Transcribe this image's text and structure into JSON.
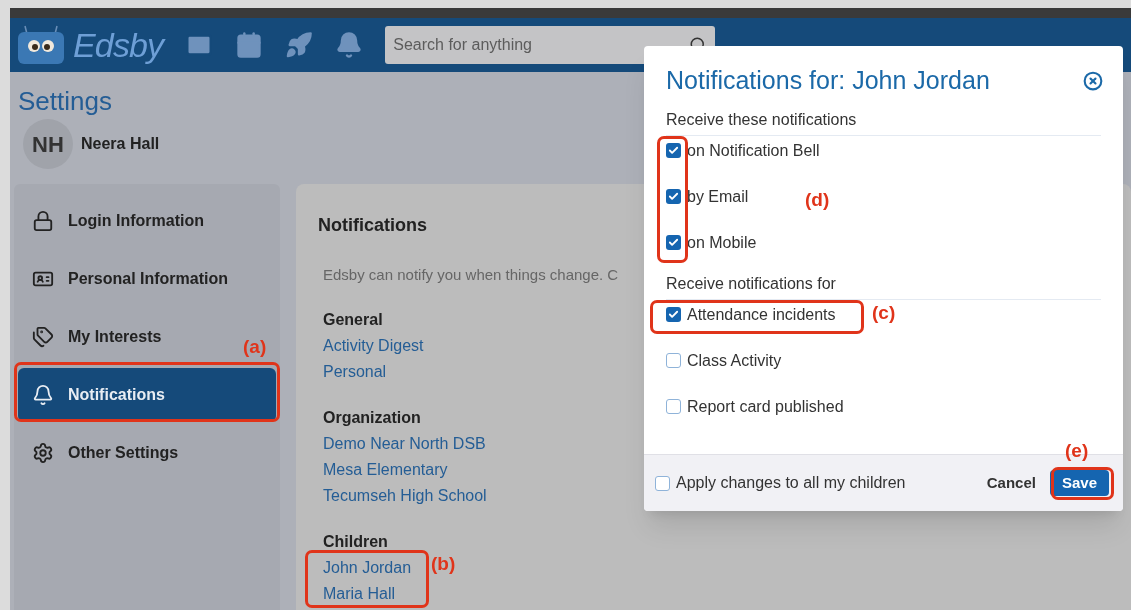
{
  "header": {
    "logo": "Edsby",
    "search": {
      "placeholder": "Search for anything"
    }
  },
  "page_title": "Settings",
  "user": {
    "initials": "NH",
    "name": "Neera Hall"
  },
  "sidebar": {
    "items": [
      {
        "label": "Login Information",
        "kind": "lock",
        "selected": false
      },
      {
        "label": "Personal Information",
        "kind": "card",
        "selected": false
      },
      {
        "label": "My Interests",
        "kind": "tags",
        "selected": false
      },
      {
        "label": "Notifications",
        "kind": "bell",
        "selected": true
      },
      {
        "label": "Other Settings",
        "kind": "gear",
        "selected": false
      }
    ]
  },
  "content": {
    "title": "Notifications",
    "description": "Edsby can notify you when things change. C",
    "sections": [
      {
        "heading": "General",
        "links": [
          "Activity Digest",
          "Personal"
        ]
      },
      {
        "heading": "Organization",
        "links": [
          "Demo Near North DSB",
          "Mesa Elementary",
          "Tecumseh High School"
        ]
      },
      {
        "heading": "Children",
        "links": [
          "John Jordan",
          "Maria Hall"
        ]
      }
    ]
  },
  "dialog": {
    "title": "Notifications for: John Jordan",
    "groups": [
      {
        "heading": "Receive these notifications",
        "options": [
          {
            "label": "on Notification Bell",
            "checked": true
          },
          {
            "label": "by Email",
            "checked": true
          },
          {
            "label": "on Mobile",
            "checked": true
          }
        ]
      },
      {
        "heading": "Receive notifications for",
        "options": [
          {
            "label": "Attendance incidents",
            "checked": true
          },
          {
            "label": "Class Activity",
            "checked": false
          },
          {
            "label": "Report card published",
            "checked": false
          }
        ]
      }
    ],
    "apply_all": {
      "label": "Apply changes to all my children",
      "checked": false
    },
    "cancel": "Cancel",
    "save": "Save"
  },
  "annotations": [
    "(a)",
    "(b)",
    "(c)",
    "(d)",
    "(e)"
  ]
}
